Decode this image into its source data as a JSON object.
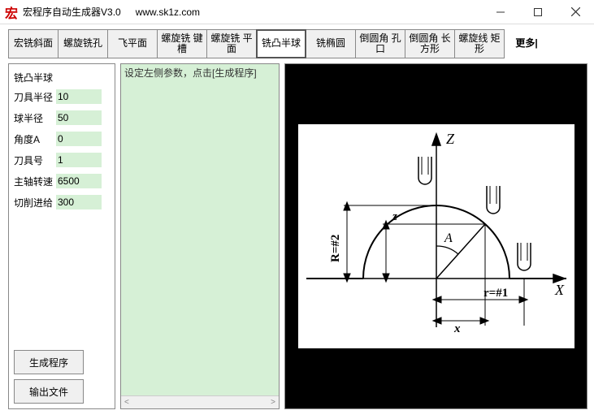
{
  "window": {
    "icon_text": "宏",
    "title": "宏程序自动生成器V3.0",
    "url": "www.sk1z.com"
  },
  "toolbar": {
    "items": [
      {
        "label": "宏铣斜面"
      },
      {
        "label": "螺旋铣孔"
      },
      {
        "label": "飞平面"
      },
      {
        "label": "螺旋铣 键槽"
      },
      {
        "label": "螺旋铣 平面"
      },
      {
        "label": "铣凸半球",
        "selected": true
      },
      {
        "label": "铣椭圆"
      },
      {
        "label": "倒圆角 孔口"
      },
      {
        "label": "倒圆角 长方形"
      },
      {
        "label": "螺旋线 矩形"
      }
    ],
    "more": "更多|"
  },
  "panel": {
    "title": "铣凸半球",
    "params": [
      {
        "label": "刀具半径",
        "value": "10"
      },
      {
        "label": "球半径",
        "value": "50"
      },
      {
        "label": "角度A",
        "value": "0"
      },
      {
        "label": "刀具号",
        "value": "1"
      },
      {
        "label": "主轴转速",
        "value": "6500"
      },
      {
        "label": "切削进给",
        "value": "300"
      }
    ],
    "gen_label": "生成程序",
    "out_label": "输出文件"
  },
  "editor": {
    "hint": "设定左侧参数，点击[生成程序]"
  },
  "diagram": {
    "z_label": "Z",
    "x_label": "X",
    "a_label": "A",
    "r_big": "R=#2",
    "r_small": "r=#1",
    "z_dim": "z",
    "x_dim": "x"
  }
}
